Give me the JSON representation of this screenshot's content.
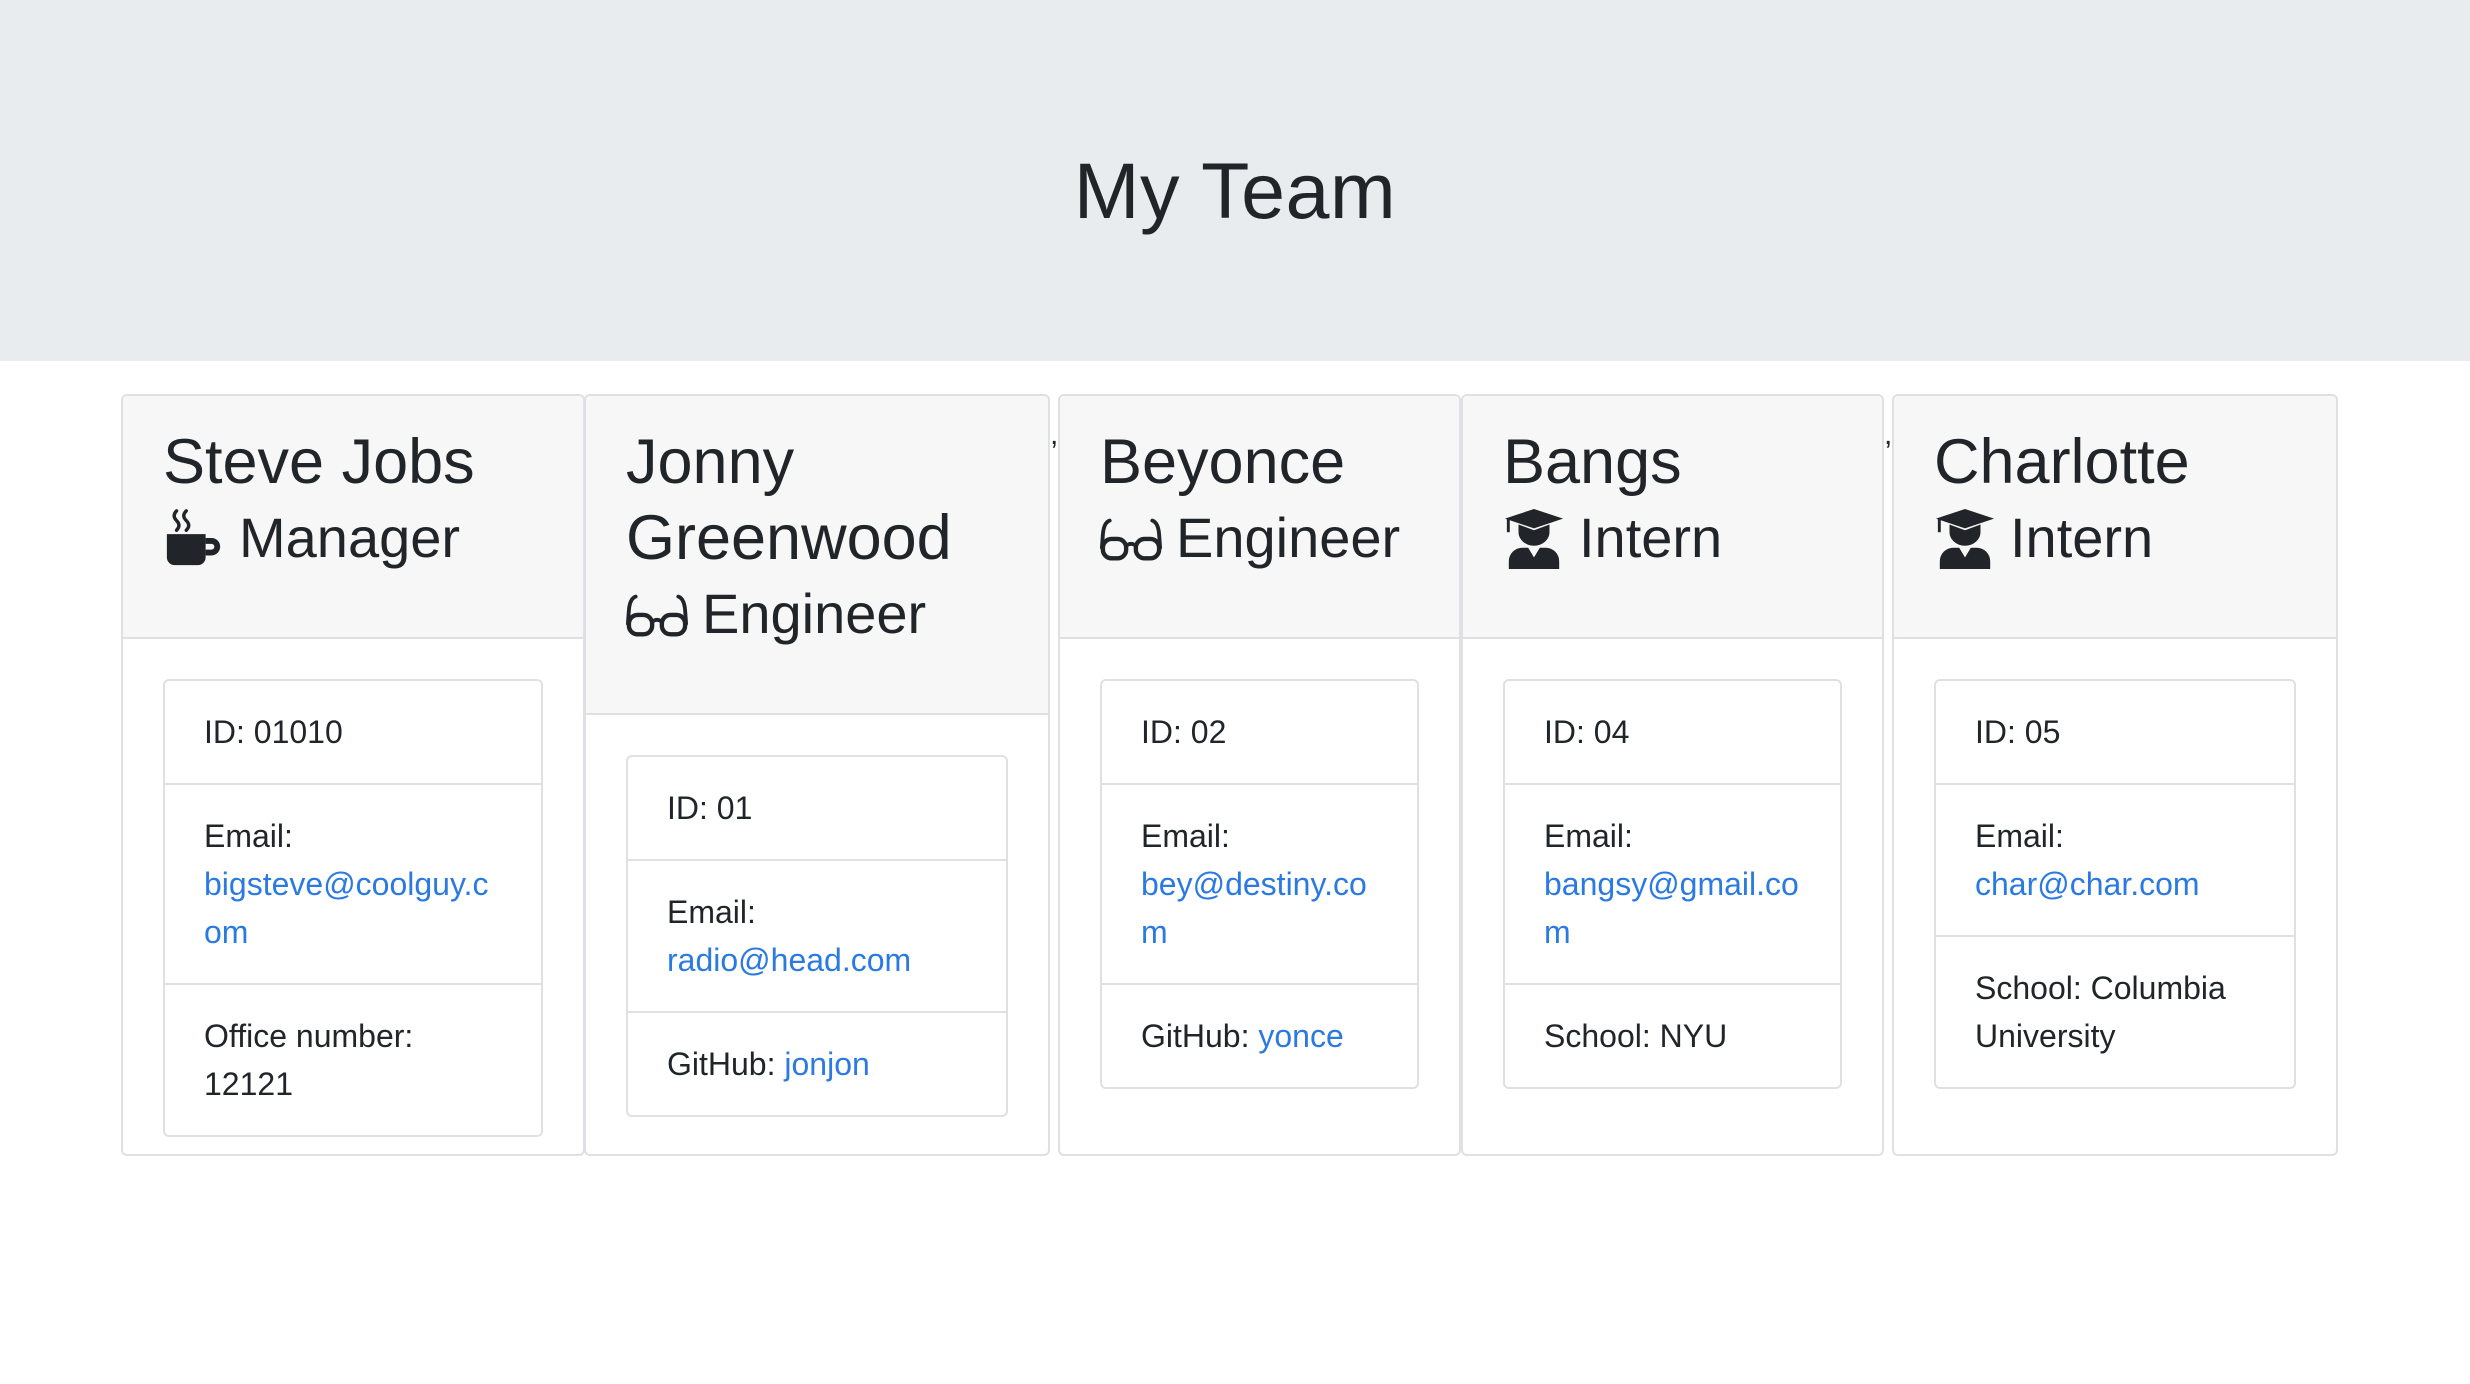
{
  "page": {
    "title": "My Team"
  },
  "team": [
    {
      "name": "Steve Jobs",
      "role": "Manager",
      "icon": "mug-icon",
      "id_text": "ID: 01010",
      "email_label": "Email:",
      "email": "bigsteve@coolguy.com",
      "extra_label": "Office number:",
      "extra_value": "12121"
    },
    {
      "name": "Jonny Greenwood",
      "role": "Engineer",
      "icon": "glasses-icon",
      "id_text": "ID: 01",
      "email_label": "Email:",
      "email": "radio@head.com",
      "extra_label": "GitHub:",
      "extra_value": "jonjon"
    },
    {
      "name": "Beyonce",
      "role": "Engineer",
      "icon": "glasses-icon",
      "id_text": "ID: 02",
      "email_label": "Email:",
      "email": "bey@destiny.com",
      "extra_label": "GitHub:",
      "extra_value": "yonce"
    },
    {
      "name": "Bangs",
      "role": "Intern",
      "icon": "graduate-icon",
      "id_text": "ID: 04",
      "email_label": "Email:",
      "email": "bangsy@gmail.com",
      "extra_label": "School:",
      "extra_value": "NYU"
    },
    {
      "name": "Charlotte",
      "role": "Intern",
      "icon": "graduate-icon",
      "id_text": "ID: 05",
      "email_label": "Email:",
      "email": "char@char.com",
      "extra_label": "School:",
      "extra_value": "Columbia University"
    }
  ],
  "separators": [
    ","
  ]
}
